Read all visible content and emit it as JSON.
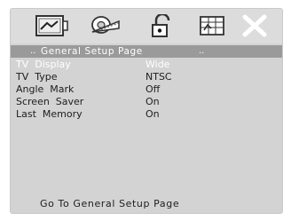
{
  "toolbar": {
    "icons": [
      {
        "name": "general-setup-icon"
      },
      {
        "name": "audio-setup-icon"
      },
      {
        "name": "lock-icon"
      },
      {
        "name": "preference-icon"
      },
      {
        "name": "exit-icon"
      }
    ]
  },
  "section": {
    "title": "General Setup Page",
    "dots_left": "..",
    "dots_right": ".."
  },
  "menu": {
    "items": [
      {
        "label": "TV  Display",
        "value": "Wide",
        "selected": true
      },
      {
        "label": "TV  Type",
        "value": "NTSC"
      },
      {
        "label": "Angle  Mark",
        "value": "Off"
      },
      {
        "label": "Screen  Saver",
        "value": "On"
      },
      {
        "label": "Last  Memory",
        "value": "On"
      }
    ]
  },
  "footer": {
    "text": "Go To General Setup Page"
  },
  "colors": {
    "screen_bg": "#d3d3d3",
    "section_bar": "#9a9a9a",
    "text": "#1d1d1d",
    "highlight_text": "#ffffff"
  }
}
